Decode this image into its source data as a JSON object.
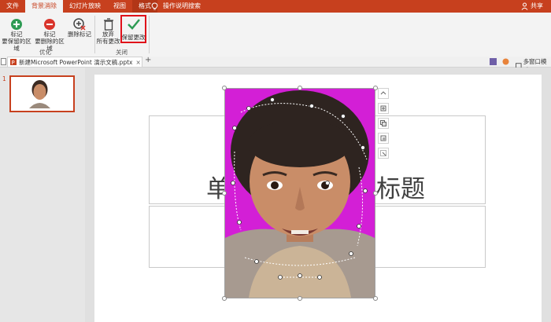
{
  "tabs": [
    "文件",
    "背景消除",
    "幻灯片放映",
    "视图",
    "格式"
  ],
  "tell_me": "操作说明搜索",
  "share": "共享",
  "ribbon": {
    "mark_keep": [
      "标记",
      "要保留的区域"
    ],
    "mark_remove": [
      "标记",
      "要删除的区域"
    ],
    "delete_mark": "删除标记",
    "group_optimize": "优化",
    "discard_changes": [
      "放弃",
      "所有更改"
    ],
    "keep_changes": "保留更改",
    "group_close": "关闭"
  },
  "document": {
    "tab_title": "新建Microsoft PowerPoint 演示文稿.pptx",
    "right_view": "多窗口模式"
  },
  "slide_thumb_number": "1",
  "slide": {
    "title_left": "单",
    "title_right": "标题"
  },
  "colors": {
    "accent": "#c7401e",
    "highlight": "#e0101a",
    "removal": "#d31fd6"
  }
}
